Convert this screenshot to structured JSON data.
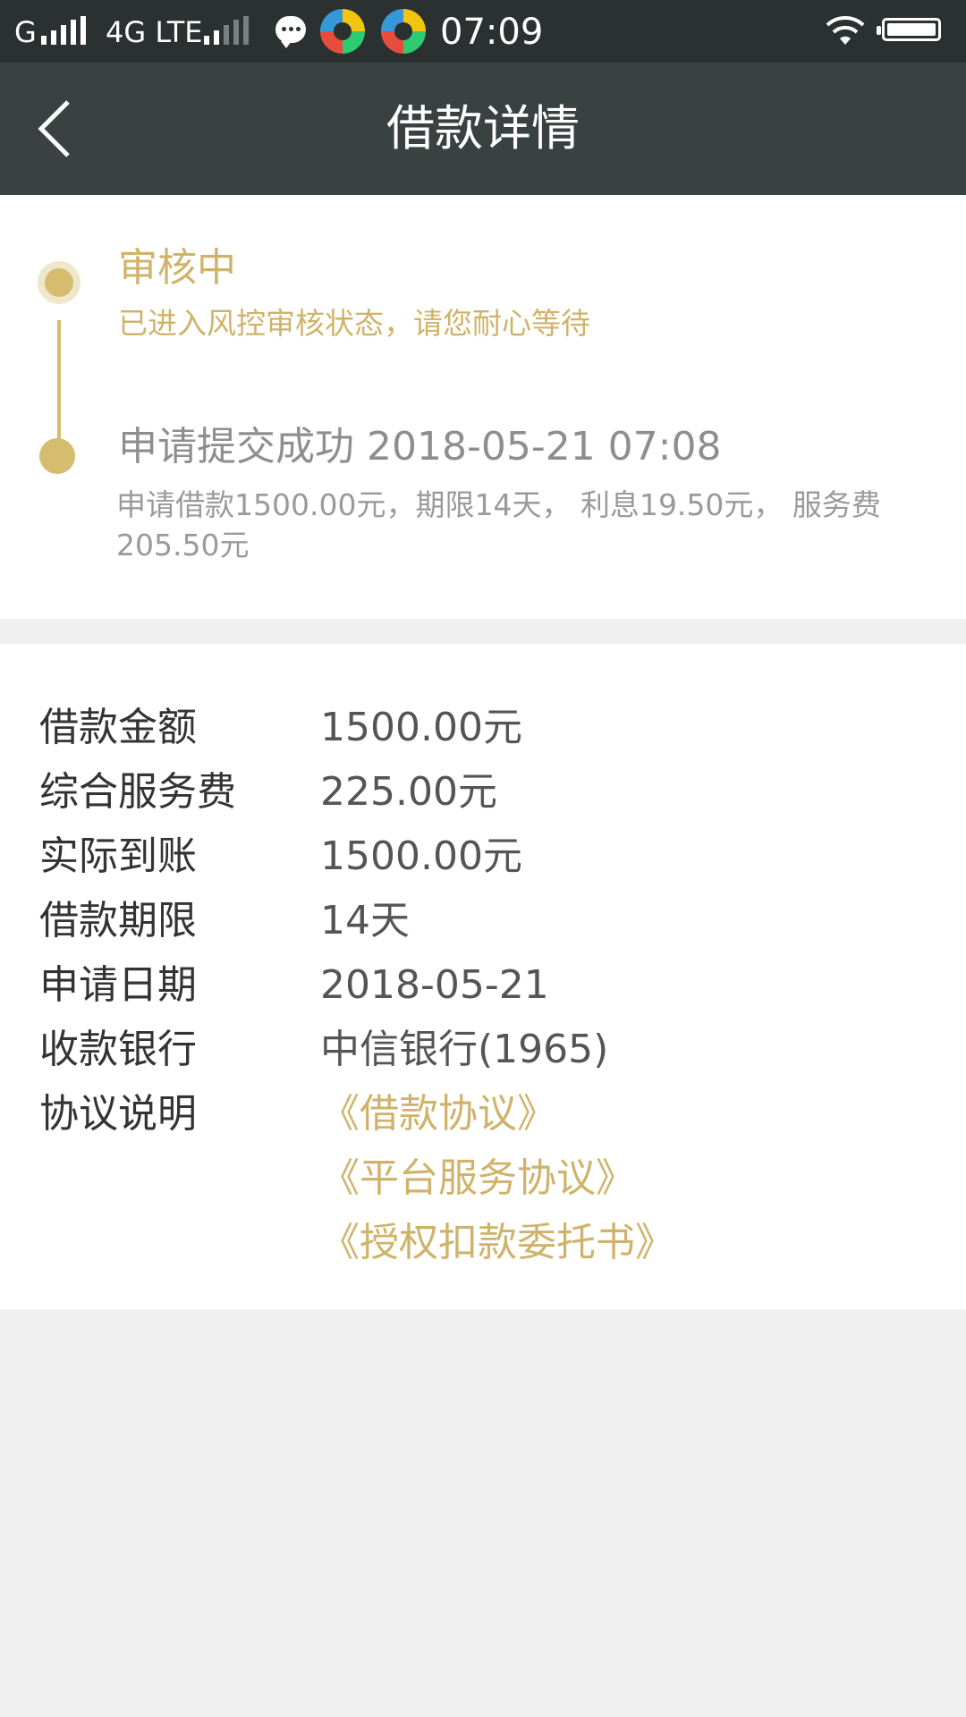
{
  "status_bar": {
    "carrier": "G",
    "network": "4G LTE",
    "time": "07:09",
    "icons": [
      "signal-icon",
      "message-icon",
      "app-icon",
      "app-icon",
      "wifi-icon",
      "battery-icon"
    ]
  },
  "nav": {
    "title": "借款详情",
    "back_icon": "chevron-left-icon"
  },
  "progress": {
    "steps": [
      {
        "title": "审核中",
        "desc": "已进入风控审核状态，请您耐心等待",
        "active": true
      },
      {
        "title": "申请提交成功 2018-05-21 07:08",
        "desc": "申请借款1500.00元，期限14天， 利息19.50元， 服务费205.50元",
        "active": false
      }
    ]
  },
  "details": {
    "rows": [
      {
        "label": "借款金额",
        "value": "1500.00元"
      },
      {
        "label": "综合服务费",
        "value": "225.00元"
      },
      {
        "label": "实际到账",
        "value": "1500.00元"
      },
      {
        "label": "借款期限",
        "value": "14天"
      },
      {
        "label": "申请日期",
        "value": "2018-05-21"
      },
      {
        "label": "收款银行",
        "value": "中信银行(1965)"
      }
    ],
    "agreement_label": "协议说明",
    "agreements": [
      "《借款协议》",
      "《平台服务协议》",
      "《授权扣款委托书》"
    ]
  },
  "colors": {
    "accent": "#cfb36a",
    "nav_bg": "#3a4141",
    "status_bg": "#2b3030",
    "page_bg": "#f0f0f0"
  }
}
